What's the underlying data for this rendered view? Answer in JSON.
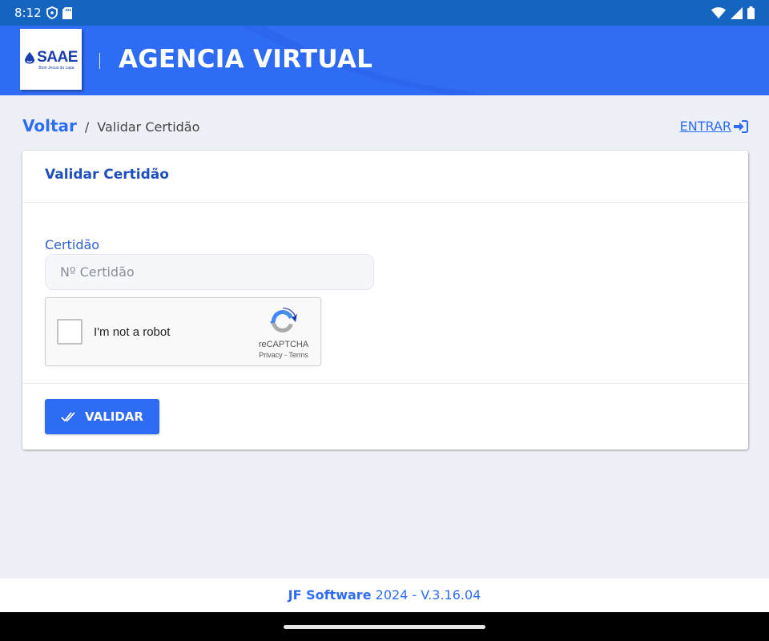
{
  "status_bar": {
    "time": "8:12"
  },
  "header": {
    "logo_text": "SAAE",
    "logo_subtext": "Bom Jesus da Lapa",
    "title": "AGENCIA VIRTUAL"
  },
  "breadcrumb": {
    "back": "Voltar",
    "separator": "/",
    "current": "Validar Certidão"
  },
  "login": {
    "label": "ENTRAR"
  },
  "card": {
    "title": "Validar Certidão",
    "field_label": "Certidão",
    "field_placeholder": "Nº Certidão",
    "field_value": ""
  },
  "recaptcha": {
    "label": "I'm not a robot",
    "brand": "reCAPTCHA",
    "links": "Privacy - Terms"
  },
  "actions": {
    "validate_label": "VALIDAR"
  },
  "footer": {
    "brand": "JF Software",
    "version": " 2024 - V.3.16.04"
  },
  "colors": {
    "primary": "#2f6cf5",
    "status_bar": "#1565c0",
    "background": "#edf1f7"
  }
}
